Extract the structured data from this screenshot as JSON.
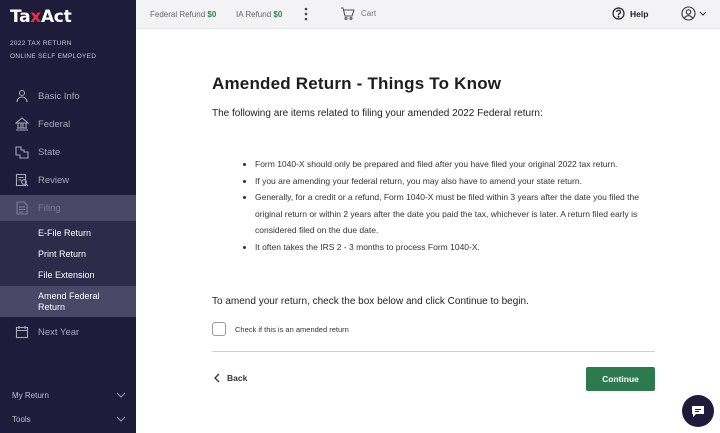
{
  "sidebar": {
    "logo_part1": "Ta",
    "logo_x": "x",
    "logo_part2": "Act",
    "return_year": "2022 TAX RETURN",
    "return_type": "ONLINE SELF EMPLOYED",
    "nav": [
      {
        "label": "Basic Info",
        "icon": "person-icon"
      },
      {
        "label": "Federal",
        "icon": "capitol-icon"
      },
      {
        "label": "State",
        "icon": "map-icon"
      },
      {
        "label": "Review",
        "icon": "review-icon"
      },
      {
        "label": "Filing",
        "icon": "document-icon"
      },
      {
        "label": "Next Year",
        "icon": "calendar-icon"
      }
    ],
    "filing_sub": [
      "E-File Return",
      "Print Return",
      "File Extension",
      "Amend Federal Return"
    ],
    "bottom": [
      {
        "label": "My Return"
      },
      {
        "label": "Tools"
      }
    ]
  },
  "topbar": {
    "federal_label": "Federal Refund",
    "federal_value": "$0",
    "ia_label": "IA Refund",
    "ia_value": "$0",
    "cart_label": "Cart",
    "help_label": "Help"
  },
  "main": {
    "title": "Amended Return - Things To Know",
    "intro": "The following are items related to filing your amended 2022 Federal return:",
    "bullets": [
      "Form 1040-X should only be prepared and filed after you have filed your original 2022 tax return.",
      "If you are amending your federal return, you may also have to amend your state return.",
      "Generally, for a credit or a refund, Form 1040-X must be filed within 3 years after the date you filed the original return or within 2 years after the date you paid the tax, whichever is later. A return filed early is considered filed on the due date.",
      "It often takes the IRS 2 - 3 months to process Form 1040-X."
    ],
    "instruction": "To amend your return, check the box below and click Continue to begin.",
    "checkbox_label": "Check if this is an amended return",
    "back_label": "Back",
    "continue_label": "Continue"
  },
  "colors": {
    "sidebar_bg": "#1f1b3a",
    "accent_green": "#2e7a4f",
    "logo_red": "#e8323c"
  }
}
